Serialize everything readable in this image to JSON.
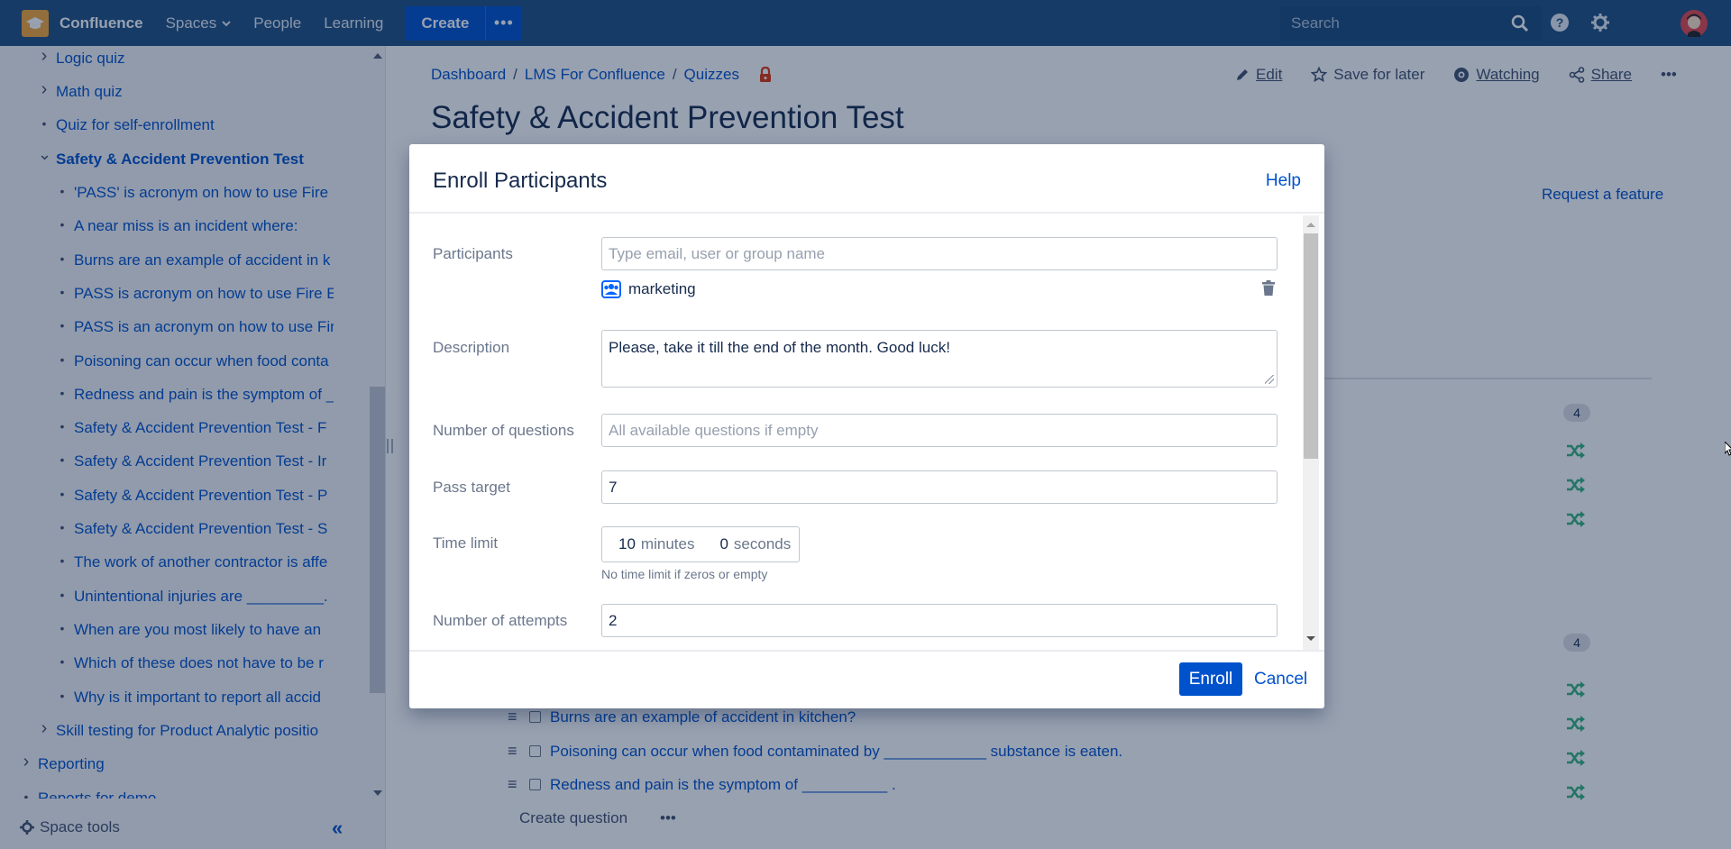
{
  "topnav": {
    "brand": "Confluence",
    "links": [
      {
        "label": "Spaces",
        "has_dropdown": true
      },
      {
        "label": "People"
      },
      {
        "label": "Learning"
      }
    ],
    "create_label": "Create",
    "more_label": "•••",
    "search_placeholder": "Search",
    "icons": [
      "search-icon",
      "help-icon",
      "gear-icon",
      "avatar"
    ]
  },
  "sidebar": {
    "items": [
      {
        "label": "Logic quiz",
        "marker": "chevron-right",
        "level": 1
      },
      {
        "label": "Math quiz",
        "marker": "chevron-right",
        "level": 1
      },
      {
        "label": "Quiz for self-enrollment",
        "marker": "bullet",
        "level": 1
      },
      {
        "label": "Safety & Accident Prevention Test",
        "marker": "chevron-down",
        "level": 1,
        "active": true
      },
      {
        "label": "'PASS' is acronym on how to use Fire",
        "marker": "bullet",
        "level": 2
      },
      {
        "label": "A near miss is an incident where:",
        "marker": "bullet",
        "level": 2
      },
      {
        "label": "Burns are an example of accident in k",
        "marker": "bullet",
        "level": 2
      },
      {
        "label": "PASS is acronym on how to use Fire E",
        "marker": "bullet",
        "level": 2
      },
      {
        "label": "PASS is an acronym on how to use Fir",
        "marker": "bullet",
        "level": 2
      },
      {
        "label": "Poisoning can occur when food conta",
        "marker": "bullet",
        "level": 2
      },
      {
        "label": "Redness and pain is the symptom of _",
        "marker": "bullet",
        "level": 2
      },
      {
        "label": "Safety & Accident Prevention Test - F",
        "marker": "bullet",
        "level": 2
      },
      {
        "label": "Safety & Accident Prevention Test - Ir",
        "marker": "bullet",
        "level": 2
      },
      {
        "label": "Safety & Accident Prevention Test - P",
        "marker": "bullet",
        "level": 2
      },
      {
        "label": "Safety & Accident Prevention Test - S",
        "marker": "bullet",
        "level": 2
      },
      {
        "label": "The work of another contractor is affe",
        "marker": "bullet",
        "level": 2
      },
      {
        "label": "Unintentional injuries are _________.",
        "marker": "bullet",
        "level": 2
      },
      {
        "label": "When are you most likely to have an",
        "marker": "bullet",
        "level": 2
      },
      {
        "label": "Which of these does not have to be r",
        "marker": "bullet",
        "level": 2
      },
      {
        "label": "Why is it important to report all accid",
        "marker": "bullet",
        "level": 2
      },
      {
        "label": "Skill testing for Product Analytic positio",
        "marker": "chevron-right",
        "level": 1
      },
      {
        "label": "Reporting",
        "marker": "chevron-right",
        "level": 0
      },
      {
        "label": "Reports for demo",
        "marker": "bullet",
        "level": 0
      }
    ],
    "space_tools_label": "Space tools",
    "collapse_label": "«"
  },
  "page": {
    "breadcrumb": [
      "Dashboard",
      "LMS For Confluence",
      "Quizzes"
    ],
    "title": "Safety & Accident Prevention Test",
    "actions": {
      "edit": "Edit",
      "save_for_later": "Save for later",
      "watching": "Watching",
      "share": "Share",
      "more": "•••"
    },
    "request_feature": "Request a feature",
    "badges": [
      "4",
      "4"
    ],
    "questions": [
      "Burns are an example of accident in kitchen?",
      "Poisoning can occur when food contaminated by ____________ substance is eaten.",
      "Redness and pain is the symptom of __________ ."
    ],
    "create_question": "Create question",
    "create_question_more": "•••"
  },
  "dialog": {
    "title": "Enroll Participants",
    "help": "Help",
    "participants": {
      "label": "Participants",
      "placeholder": "Type email, user or group name",
      "selected": "marketing"
    },
    "description": {
      "label": "Description",
      "value": "Please, take it till the end of the month. Good luck!"
    },
    "num_questions": {
      "label": "Number of questions",
      "placeholder": "All available questions if empty"
    },
    "pass_target": {
      "label": "Pass target",
      "value": "7"
    },
    "time_limit": {
      "label": "Time limit",
      "minutes": "10",
      "minutes_unit": "minutes",
      "seconds": "0",
      "seconds_unit": "seconds",
      "hint": "No time limit if zeros or empty"
    },
    "attempts": {
      "label": "Number of attempts",
      "value": "2"
    },
    "enroll_label": "Enroll",
    "cancel_label": "Cancel"
  },
  "colors": {
    "nav_bg": "#205081",
    "primary": "#0052cc",
    "shuffle": "#36b37e",
    "lock": "#de350b"
  }
}
